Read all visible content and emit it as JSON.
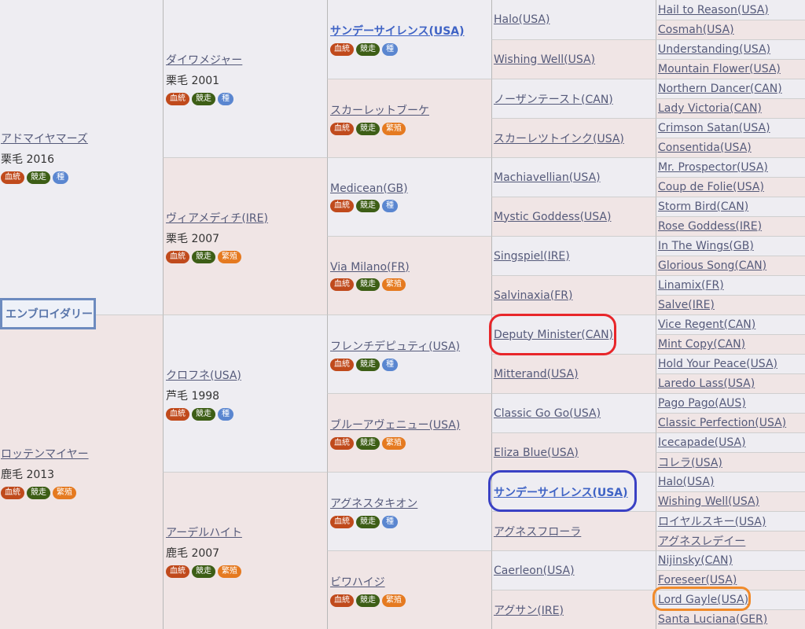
{
  "badges": {
    "blood": "血統",
    "race": "競走",
    "sire": "種",
    "broodmare": "繁殖"
  },
  "subject": {
    "name": "エンブロイダリー"
  },
  "g1": [
    {
      "name": "アドマイヤマーズ",
      "info": "栗毛 2016",
      "badges": [
        "blood",
        "race",
        "sire"
      ]
    },
    {
      "name": "ロッテンマイヤー",
      "info": "鹿毛 2013",
      "badges": [
        "blood",
        "race",
        "broodmare"
      ]
    }
  ],
  "g2": [
    {
      "name": "ダイワメジャー",
      "info": "栗毛 2001",
      "badges": [
        "blood",
        "race",
        "sire"
      ]
    },
    {
      "name": "ヴィアメディチ(IRE)",
      "info": "栗毛 2007",
      "badges": [
        "blood",
        "race",
        "broodmare"
      ]
    },
    {
      "name": "クロフネ(USA)",
      "info": "芦毛 1998",
      "badges": [
        "blood",
        "race",
        "sire"
      ]
    },
    {
      "name": "アーデルハイト",
      "info": "鹿毛 2007",
      "badges": [
        "blood",
        "race",
        "broodmare"
      ]
    }
  ],
  "g3": [
    {
      "name": "サンデーサイレンス(USA)",
      "bold": true,
      "badges": [
        "blood",
        "race",
        "sire"
      ]
    },
    {
      "name": "スカーレットブーケ",
      "badges": [
        "blood",
        "race",
        "broodmare"
      ]
    },
    {
      "name": "Medicean(GB)",
      "badges": [
        "blood",
        "race",
        "sire"
      ]
    },
    {
      "name": "Via Milano(FR)",
      "badges": [
        "blood",
        "race",
        "broodmare"
      ]
    },
    {
      "name": "フレンチデピュティ(USA)",
      "badges": [
        "blood",
        "race",
        "sire"
      ]
    },
    {
      "name": "ブルーアヴェニュー(USA)",
      "badges": [
        "blood",
        "race",
        "broodmare"
      ]
    },
    {
      "name": "アグネスタキオン",
      "badges": [
        "blood",
        "race",
        "sire"
      ]
    },
    {
      "name": "ビワハイジ",
      "badges": [
        "blood",
        "race",
        "broodmare"
      ]
    }
  ],
  "g4": [
    {
      "name": "Halo(USA)"
    },
    {
      "name": "Wishing Well(USA)"
    },
    {
      "name": "ノーザンテースト(CAN)"
    },
    {
      "name": "スカーレツトインク(USA)"
    },
    {
      "name": "Machiavellian(USA)"
    },
    {
      "name": "Mystic Goddess(USA)"
    },
    {
      "name": "Singspiel(IRE)"
    },
    {
      "name": "Salvinaxia(FR)"
    },
    {
      "name": "Deputy Minister(CAN)"
    },
    {
      "name": "Mitterand(USA)"
    },
    {
      "name": "Classic Go Go(USA)"
    },
    {
      "name": "Eliza Blue(USA)"
    },
    {
      "name": "サンデーサイレンス(USA)",
      "bold": true
    },
    {
      "name": "アグネスフローラ"
    },
    {
      "name": "Caerleon(USA)"
    },
    {
      "name": "アグサン(IRE)"
    }
  ],
  "g5": [
    {
      "name": "Hail to Reason(USA)"
    },
    {
      "name": "Cosmah(USA)"
    },
    {
      "name": "Understanding(USA)"
    },
    {
      "name": "Mountain Flower(USA)"
    },
    {
      "name": "Northern Dancer(CAN)"
    },
    {
      "name": "Lady Victoria(CAN)"
    },
    {
      "name": "Crimson Satan(USA)"
    },
    {
      "name": "Consentida(USA)"
    },
    {
      "name": "Mr. Prospector(USA)"
    },
    {
      "name": "Coup de Folie(USA)"
    },
    {
      "name": "Storm Bird(CAN)"
    },
    {
      "name": "Rose Goddess(IRE)"
    },
    {
      "name": "In The Wings(GB)"
    },
    {
      "name": "Glorious Song(CAN)"
    },
    {
      "name": "Linamix(FR)"
    },
    {
      "name": "Salve(IRE)"
    },
    {
      "name": "Vice Regent(CAN)"
    },
    {
      "name": "Mint Copy(CAN)"
    },
    {
      "name": "Hold Your Peace(USA)"
    },
    {
      "name": "Laredo Lass(USA)"
    },
    {
      "name": "Pago Pago(AUS)"
    },
    {
      "name": "Classic Perfection(USA)"
    },
    {
      "name": "Icecapade(USA)"
    },
    {
      "name": "コレラ(USA)"
    },
    {
      "name": "Halo(USA)"
    },
    {
      "name": "Wishing Well(USA)"
    },
    {
      "name": "ロイヤルスキー(USA)"
    },
    {
      "name": "アグネスレデイー"
    },
    {
      "name": "Nijinsky(CAN)"
    },
    {
      "name": "Foreseer(USA)"
    },
    {
      "name": "Lord Gayle(USA)"
    },
    {
      "name": "Santa Luciana(GER)"
    }
  ],
  "highlight_colors": {
    "red": "#e8262a",
    "blue": "#3a41c4",
    "orange": "#f08a2a"
  }
}
